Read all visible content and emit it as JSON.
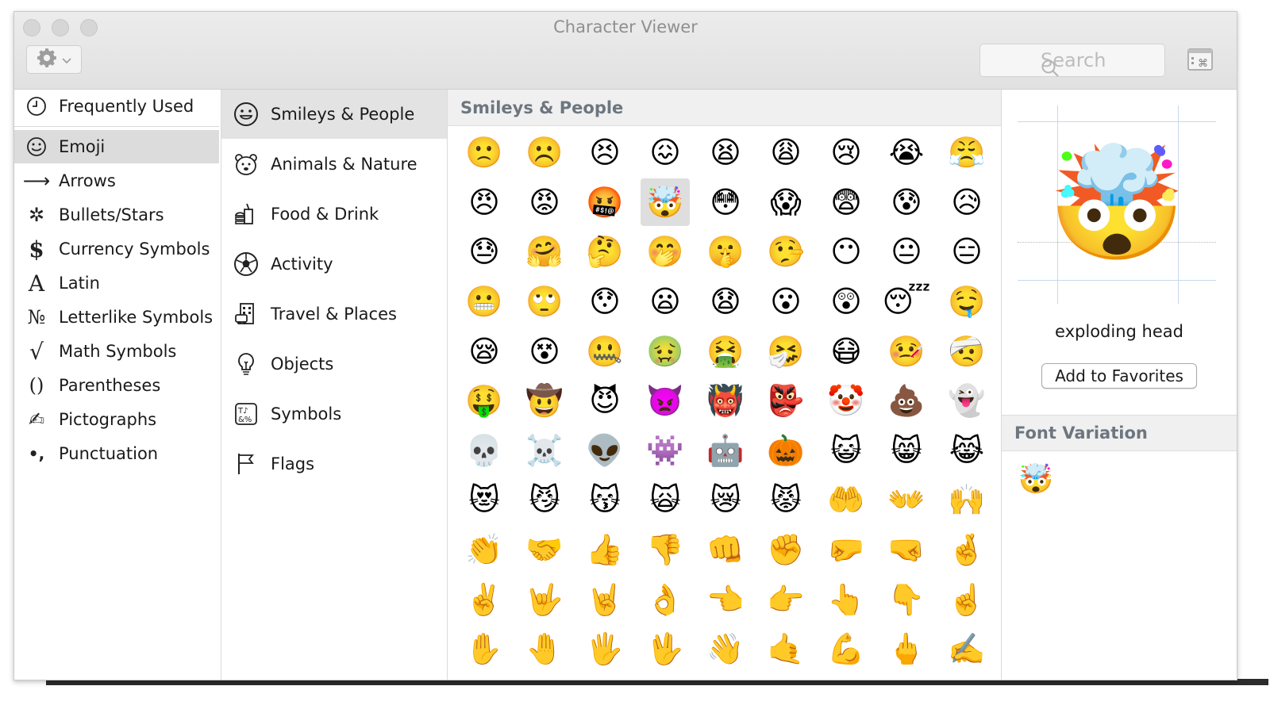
{
  "window": {
    "title": "Character Viewer"
  },
  "toolbar": {
    "search_placeholder": "Search",
    "gear_icon": "gear-icon",
    "keyboard_icon": "keyboard-viewer-icon"
  },
  "sidebar": {
    "items": [
      {
        "label": "Frequently Used",
        "icon": "clock-icon",
        "glyph": "◷"
      },
      {
        "label": "Emoji",
        "icon": "smiley-icon",
        "glyph": "☺",
        "selected": true
      },
      {
        "label": "Arrows",
        "icon": "arrow-icon",
        "glyph": "⟶"
      },
      {
        "label": "Bullets/Stars",
        "icon": "star-icon",
        "glyph": "✲"
      },
      {
        "label": "Currency Symbols",
        "icon": "dollar-icon",
        "glyph": "$"
      },
      {
        "label": "Latin",
        "icon": "latin-a-icon",
        "glyph": "A"
      },
      {
        "label": "Letterlike Symbols",
        "icon": "numero-icon",
        "glyph": "№"
      },
      {
        "label": "Math Symbols",
        "icon": "sqrt-icon",
        "glyph": "√"
      },
      {
        "label": "Parentheses",
        "icon": "parentheses-icon",
        "glyph": "()"
      },
      {
        "label": "Pictographs",
        "icon": "pictograph-icon",
        "glyph": "✍"
      },
      {
        "label": "Punctuation",
        "icon": "punctuation-icon",
        "glyph": "•,"
      }
    ]
  },
  "categories": {
    "items": [
      {
        "label": "Smileys & People",
        "icon": "smiley-face-icon",
        "selected": true
      },
      {
        "label": "Animals & Nature",
        "icon": "bear-icon"
      },
      {
        "label": "Food & Drink",
        "icon": "burger-icon"
      },
      {
        "label": "Activity",
        "icon": "soccer-ball-icon"
      },
      {
        "label": "Travel & Places",
        "icon": "building-icon"
      },
      {
        "label": "Objects",
        "icon": "lightbulb-icon"
      },
      {
        "label": "Symbols",
        "icon": "symbols-icon"
      },
      {
        "label": "Flags",
        "icon": "flag-icon"
      }
    ]
  },
  "grid": {
    "header": "Smileys & People",
    "selected_index": 12,
    "emojis": [
      "🙁",
      "☹️",
      "😣",
      "😖",
      "😫",
      "😩",
      "😢",
      "😭",
      "😤",
      "😠",
      "😡",
      "🤬",
      "🤯",
      "😳",
      "😱",
      "😨",
      "😰",
      "😥",
      "😓",
      "🤗",
      "🤔",
      "🤭",
      "🤫",
      "🤥",
      "😶",
      "😐",
      "😑",
      "😬",
      "🙄",
      "😯",
      "😦",
      "😧",
      "😮",
      "😲",
      "😴",
      "🤤",
      "😪",
      "😵",
      "🤐",
      "🤢",
      "🤮",
      "🤧",
      "😷",
      "🤒",
      "🤕",
      "🤑",
      "🤠",
      "😈",
      "👿",
      "👹",
      "👺",
      "🤡",
      "💩",
      "👻",
      "💀",
      "☠️",
      "👽",
      "👾",
      "🤖",
      "🎃",
      "😺",
      "😸",
      "😹",
      "😻",
      "😼",
      "😽",
      "🙀",
      "😿",
      "😾",
      "🤲",
      "👐",
      "🙌",
      "👏",
      "🤝",
      "👍",
      "👎",
      "👊",
      "✊",
      "🤛",
      "🤜",
      "🤞",
      "✌️",
      "🤟",
      "🤘",
      "👌",
      "👈",
      "👉",
      "👆",
      "👇",
      "☝️",
      "✋",
      "🤚",
      "🖐️",
      "🖖",
      "👋",
      "🤙",
      "💪",
      "🖕",
      "✍️"
    ]
  },
  "detail": {
    "preview_glyph": "🤯",
    "name": "exploding head",
    "add_favorites_label": "Add to Favorites",
    "font_variation_header": "Font Variation",
    "variations": [
      "🤯"
    ]
  }
}
